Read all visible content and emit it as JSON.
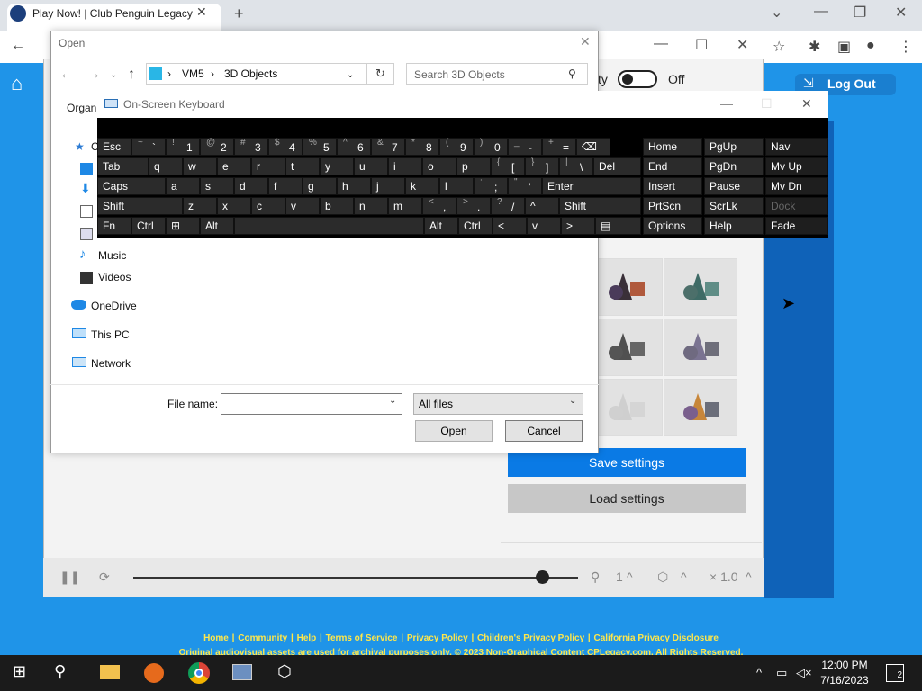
{
  "browser": {
    "tab_title": "Play Now! | Club Penguin Legacy",
    "new_tab": "+",
    "tab_close": "✕"
  },
  "site": {
    "logout_label": "Log Out",
    "toggle_label": "ty",
    "toggle_state": "Off",
    "save_settings": "Save settings",
    "load_settings": "Load settings",
    "footer_links": [
      "Home",
      "Community",
      "Help",
      "Terms of Service",
      "Privacy Policy",
      "Children's Privacy Policy",
      "California Privacy Disclosure"
    ],
    "footer_note": "Original audiovisual assets are used for archival purposes only. © 2023 Non-Graphical Content CPLegacy.com. All Rights Reserved.",
    "slider_value": 0.92,
    "counter_1": "1",
    "speed": "× 1.0"
  },
  "open_dialog": {
    "title": "Open",
    "path": [
      "VM5",
      "3D Objects"
    ],
    "search_placeholder": "Search 3D Objects",
    "organize": "Organi",
    "nav_items": [
      "Music",
      "Videos",
      "OneDrive",
      "This PC",
      "Network"
    ],
    "quick_access_fragment": "C",
    "file_name_label": "File name:",
    "file_name_value": "",
    "filter": "All files",
    "open_btn": "Open",
    "cancel_btn": "Cancel"
  },
  "keyboard": {
    "title": "On-Screen Keyboard",
    "row1": [
      {
        "m": "Esc"
      },
      {
        "t": "~",
        "m": "`"
      },
      {
        "t": "!",
        "m": "1"
      },
      {
        "t": "@",
        "m": "2"
      },
      {
        "t": "#",
        "m": "3"
      },
      {
        "t": "$",
        "m": "4"
      },
      {
        "t": "%",
        "m": "5"
      },
      {
        "t": "^",
        "m": "6"
      },
      {
        "t": "&",
        "m": "7"
      },
      {
        "t": "*",
        "m": "8"
      },
      {
        "t": "(",
        "m": "9"
      },
      {
        "t": ")",
        "m": "0"
      },
      {
        "t": "_",
        "m": "-"
      },
      {
        "t": "+",
        "m": "="
      },
      {
        "m": "⌫"
      }
    ],
    "row2": [
      {
        "m": "Tab"
      },
      {
        "m": "q"
      },
      {
        "m": "w"
      },
      {
        "m": "e"
      },
      {
        "m": "r"
      },
      {
        "m": "t"
      },
      {
        "m": "y"
      },
      {
        "m": "u"
      },
      {
        "m": "i"
      },
      {
        "m": "o"
      },
      {
        "m": "p"
      },
      {
        "t": "{",
        "m": "["
      },
      {
        "t": "}",
        "m": "]"
      },
      {
        "t": "|",
        "m": "\\"
      },
      {
        "m": "Del"
      }
    ],
    "row3": [
      {
        "m": "Caps"
      },
      {
        "m": "a"
      },
      {
        "m": "s"
      },
      {
        "m": "d"
      },
      {
        "m": "f"
      },
      {
        "m": "g"
      },
      {
        "m": "h"
      },
      {
        "m": "j"
      },
      {
        "m": "k"
      },
      {
        "m": "l"
      },
      {
        "t": ":",
        "m": ";"
      },
      {
        "t": "\"",
        "m": "'"
      },
      {
        "m": "Enter"
      }
    ],
    "row4": [
      {
        "m": "Shift"
      },
      {
        "m": "z"
      },
      {
        "m": "x"
      },
      {
        "m": "c"
      },
      {
        "m": "v"
      },
      {
        "m": "b"
      },
      {
        "m": "n"
      },
      {
        "m": "m"
      },
      {
        "t": "<",
        "m": ","
      },
      {
        "t": ">",
        "m": "."
      },
      {
        "t": "?",
        "m": "/"
      },
      {
        "m": "^"
      },
      {
        "m": "Shift"
      }
    ],
    "row5": [
      {
        "m": "Fn"
      },
      {
        "m": "Ctrl"
      },
      {
        "m": "⊞"
      },
      {
        "m": "Alt"
      },
      {
        "m": ""
      },
      {
        "m": "Alt"
      },
      {
        "m": "Ctrl"
      },
      {
        "m": "<"
      },
      {
        "m": "v"
      },
      {
        "m": ">"
      },
      {
        "m": "▤"
      }
    ],
    "nav_keys": [
      [
        "Home",
        "PgUp",
        "Nav"
      ],
      [
        "End",
        "PgDn",
        "Mv Up"
      ],
      [
        "Insert",
        "Pause",
        "Mv Dn"
      ],
      [
        "PrtScn",
        "ScrLk",
        "Dock"
      ],
      [
        "Options",
        "Help",
        "Fade"
      ]
    ]
  },
  "taskbar": {
    "time": "12:00 PM",
    "date": "7/16/2023",
    "notifications": "2"
  }
}
